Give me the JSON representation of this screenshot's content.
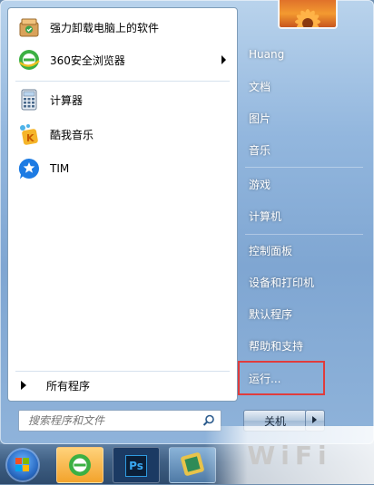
{
  "left_pane": {
    "programs": [
      {
        "label": "强力卸载电脑上的软件",
        "icon": "uninstall-box-icon"
      },
      {
        "label": "360安全浏览器",
        "icon": "360-browser-icon",
        "has_submenu": true
      },
      {
        "label": "计算器",
        "icon": "calculator-icon"
      },
      {
        "label": "酷我音乐",
        "icon": "kuwo-music-icon"
      },
      {
        "label": "TIM",
        "icon": "tim-icon"
      }
    ],
    "all_programs_label": "所有程序"
  },
  "search": {
    "placeholder": "搜索程序和文件"
  },
  "right_pane": {
    "items": [
      {
        "label": "Huang"
      },
      {
        "label": "文档"
      },
      {
        "label": "图片"
      },
      {
        "label": "音乐"
      },
      {
        "label": "游戏"
      },
      {
        "label": "计算机"
      },
      {
        "label": "控制面板"
      },
      {
        "label": "设备和打印机"
      },
      {
        "label": "默认程序"
      },
      {
        "label": "帮助和支持"
      },
      {
        "label": "运行..."
      }
    ]
  },
  "shutdown": {
    "label": "关机"
  },
  "taskbar": {
    "buttons": [
      "start-orb",
      "360-browser-icon",
      "photoshop-icon",
      "app-icon"
    ],
    "ps_label": "Ps"
  },
  "watermark": {
    "text": "WiFi"
  },
  "colors": {
    "highlight": "#e03c3c",
    "accent": "#2e4b6d"
  }
}
